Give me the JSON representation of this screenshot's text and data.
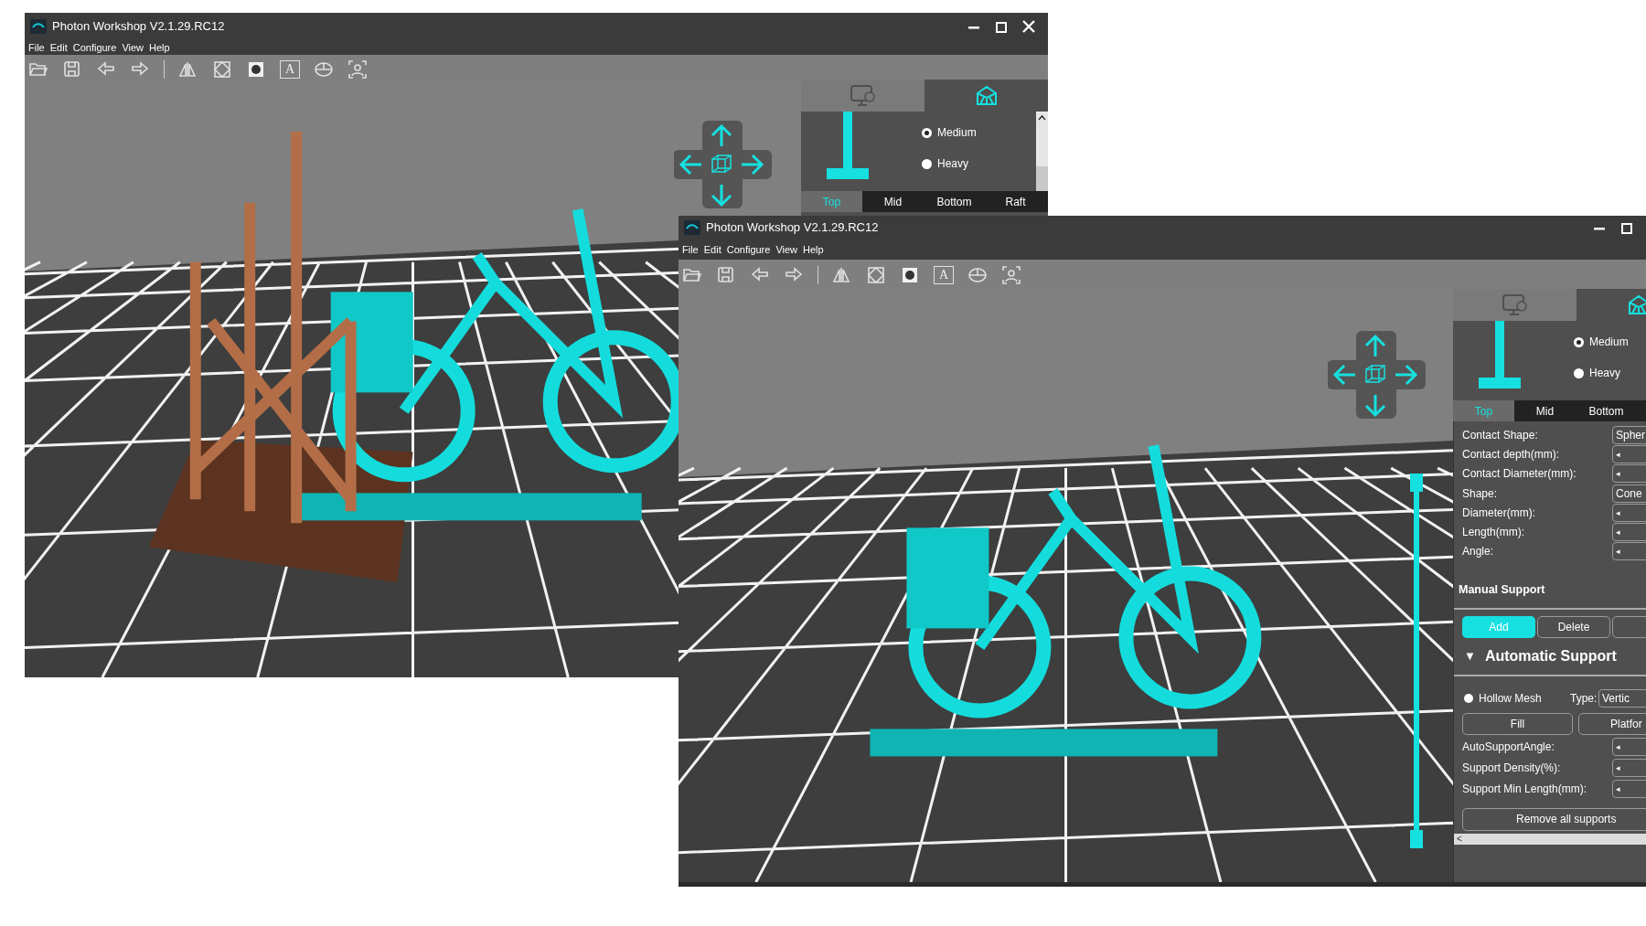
{
  "windows": [
    {
      "title": "Photon Workshop V2.1.29.RC12",
      "window_controls": [
        {
          "kind": "minimize"
        },
        {
          "kind": "maximize"
        },
        {
          "kind": "close"
        }
      ],
      "menu": [
        "File",
        "Edit",
        "Configure",
        "View",
        "Help"
      ],
      "toolbar": [
        {
          "kind": "open"
        },
        {
          "kind": "save"
        },
        {
          "kind": "undo"
        },
        {
          "kind": "redo"
        },
        {
          "kind": "separator"
        },
        {
          "kind": "mirror"
        },
        {
          "kind": "grid"
        },
        {
          "kind": "hollow"
        },
        {
          "kind": "text",
          "label": "A"
        },
        {
          "kind": "disc"
        },
        {
          "kind": "scan"
        }
      ],
      "viewport": {
        "kind": "picture",
        "supports": true
      },
      "panel": {
        "tabs": [
          {
            "kind": "settings",
            "selected": false
          },
          {
            "kind": "supports",
            "selected": true
          }
        ],
        "density": [
          {
            "label": "Medium",
            "selected": true
          },
          {
            "label": "Heavy",
            "selected": false
          }
        ],
        "support_tabs": [
          {
            "label": "Top",
            "selected": true
          },
          {
            "label": "Mid",
            "selected": false
          },
          {
            "label": "Bottom",
            "selected": false
          },
          {
            "label": "Raft",
            "selected": false
          }
        ]
      }
    },
    {
      "title": "Photon Workshop V2.1.29.RC12",
      "window_controls": [
        {
          "kind": "minimize"
        },
        {
          "kind": "maximize"
        }
      ],
      "menu": [
        "File",
        "Edit",
        "Configure",
        "View",
        "Help"
      ],
      "toolbar": [
        {
          "kind": "open"
        },
        {
          "kind": "save"
        },
        {
          "kind": "undo"
        },
        {
          "kind": "redo"
        },
        {
          "kind": "separator"
        },
        {
          "kind": "mirror"
        },
        {
          "kind": "grid"
        },
        {
          "kind": "hollow"
        },
        {
          "kind": "text",
          "label": "A"
        },
        {
          "kind": "disc"
        },
        {
          "kind": "scan"
        }
      ],
      "viewport": {
        "kind": "picture",
        "supports": false
      },
      "layer_slider": {
        "kind": "range"
      },
      "panel": {
        "tabs": [
          {
            "kind": "settings",
            "selected": false
          },
          {
            "kind": "supports",
            "selected": true
          }
        ],
        "density": [
          {
            "label": "Medium",
            "selected": true
          },
          {
            "label": "Heavy",
            "selected": false
          }
        ],
        "support_tabs": [
          {
            "label": "Top",
            "selected": true
          },
          {
            "label": "Mid",
            "selected": false
          },
          {
            "label": "Bottom",
            "selected": false
          }
        ],
        "fields": [
          {
            "label": "Contact Shape:",
            "kind": "dropdown",
            "value": "Spher"
          },
          {
            "label": "Contact depth(mm):",
            "kind": "spinner",
            "arrow": "◂"
          },
          {
            "label": "Contact Diameter(mm):",
            "kind": "spinner",
            "arrow": "◂"
          },
          {
            "label": "Shape:",
            "kind": "dropdown",
            "value": "Cone"
          },
          {
            "label": "Diameter(mm):",
            "kind": "spinner",
            "arrow": "◂"
          },
          {
            "label": "Length(mm):",
            "kind": "spinner",
            "arrow": "◂"
          },
          {
            "label": "Angle:",
            "kind": "spinner",
            "arrow": "◂"
          }
        ],
        "manual_support": {
          "title": "Manual Support",
          "buttons": [
            {
              "label": "Add",
              "selected": true
            },
            {
              "label": "Delete",
              "selected": false
            }
          ]
        },
        "auto_support": {
          "toggle": "▼",
          "title": "Automatic Support",
          "hollow_mesh": {
            "label": "Hollow Mesh",
            "checked": false
          },
          "type_label": "Type:",
          "type_value": "Vertic",
          "buttons": [
            "Fill",
            "Platfor"
          ],
          "fields": [
            {
              "label": "AutoSupportAngle:",
              "arrow": "◂"
            },
            {
              "label": "Support Density(%):",
              "arrow": "◂"
            },
            {
              "label": "Support Min Length(mm):",
              "arrow": "◂"
            }
          ],
          "remove_button": "Remove all supports"
        },
        "scrollbar_arrow": "<"
      }
    }
  ]
}
